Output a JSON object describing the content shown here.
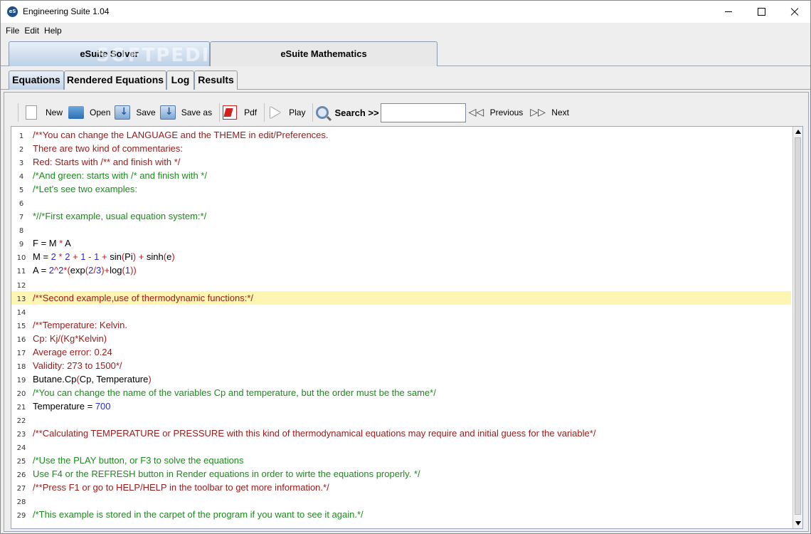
{
  "window": {
    "title": "Engineering Suite 1.04",
    "icon_name": "esuite-app-icon",
    "icon_text": "eS"
  },
  "menu": {
    "items": [
      "File",
      "Edit",
      "Help"
    ]
  },
  "main_tabs": [
    {
      "label": "eSuite Solver",
      "active": true
    },
    {
      "label": "eSuite Mathematics",
      "active": false
    }
  ],
  "watermark": "SOFTPEDIA",
  "sub_tabs": [
    {
      "label": "Equations",
      "active": true
    },
    {
      "label": "Rendered Equations",
      "active": false
    },
    {
      "label": "Log",
      "active": false
    },
    {
      "label": "Results",
      "active": false
    }
  ],
  "toolbar": {
    "new_label": "New",
    "open_label": "Open",
    "save_label": "Save",
    "saveas_label": "Save as",
    "pdf_label": "Pdf",
    "play_label": "Play",
    "search_label": "Search >>",
    "search_value": "",
    "previous_label": "Previous",
    "next_label": "Next",
    "icons": [
      "new-file-icon",
      "open-folder-icon",
      "save-icon",
      "save-as-icon",
      "pdf-icon",
      "play-icon",
      "search-icon",
      "previous-icon",
      "next-icon"
    ]
  },
  "editor": {
    "highlighted_line": 13,
    "colors": {
      "comment_red": "#9a1a1a",
      "comment_green": "#1d8a1d",
      "number": "#2a2ad8",
      "operator": "#c01818",
      "highlight": "#fdf6b2"
    },
    "lines": [
      {
        "n": "1",
        "text": "/**You can change the LANGUAGE and the THEME in edit/Preferences.",
        "style": "red"
      },
      {
        "n": "2",
        "text": "There are two kind of commentaries:",
        "style": "red"
      },
      {
        "n": "3",
        "text": "Red: Starts with /** and finish with */",
        "style": "red"
      },
      {
        "n": "4",
        "text": "/*And green: starts with /* and finish with */",
        "style": "green"
      },
      {
        "n": "5",
        "text": "/*Let's see two examples:",
        "style": "green"
      },
      {
        "n": "6",
        "text": "",
        "style": "blk"
      },
      {
        "n": "7",
        "text": "*//*First example, usual equation system:*/",
        "style": "green"
      },
      {
        "n": "8",
        "text": "",
        "style": "blk"
      },
      {
        "n": "9",
        "text": "F = M * A",
        "style": "blk"
      },
      {
        "n": "10",
        "text": "M = 2 * 2 + 1 - 1 + sin(Pi) + sinh(e)",
        "style": "blk"
      },
      {
        "n": "11",
        "text": "A = 2^2*(exp(2/3)+log(1))",
        "style": "blk"
      },
      {
        "n": "12",
        "text": "",
        "style": "blk"
      },
      {
        "n": "13",
        "text": "/**Second example,use of thermodynamic functions:*/",
        "style": "red"
      },
      {
        "n": "14",
        "text": "",
        "style": "blk"
      },
      {
        "n": "15",
        "text": "/**Temperature: Kelvin.",
        "style": "red"
      },
      {
        "n": "16",
        "text": "Cp: Kj/(Kg*Kelvin)",
        "style": "red"
      },
      {
        "n": "17",
        "text": "Average error: 0.24",
        "style": "red"
      },
      {
        "n": "18",
        "text": "Validity: 273 to 1500*/",
        "style": "red"
      },
      {
        "n": "19",
        "text": "Butane.Cp(Cp, Temperature)",
        "style": "blk"
      },
      {
        "n": "20",
        "text": "/*You can change the name of the variables Cp and temperature, but the order must be the same*/",
        "style": "green"
      },
      {
        "n": "21",
        "text": "Temperature = 700",
        "style": "blk"
      },
      {
        "n": "22",
        "text": "",
        "style": "blk"
      },
      {
        "n": "23",
        "text": "/**Calculating TEMPERATURE or PRESSURE with this kind of thermodynamical equations may require and initial guess for the variable*/",
        "style": "red"
      },
      {
        "n": "24",
        "text": "",
        "style": "blk"
      },
      {
        "n": "25",
        "text": "/*Use the PLAY button, or F3 to solve the equations",
        "style": "green"
      },
      {
        "n": "26",
        "text": "Use F4 or the REFRESH button in Render equations in order to wirte the equations properly. */",
        "style": "green"
      },
      {
        "n": "27",
        "text": "/**Press F1 or go to HELP/HELP in the toolbar to get more information.*/",
        "style": "red"
      },
      {
        "n": "28",
        "text": "",
        "style": "blk"
      },
      {
        "n": "29",
        "text": "/*This example is stored in the carpet of the program if you want to see it again.*/",
        "style": "green"
      }
    ]
  }
}
